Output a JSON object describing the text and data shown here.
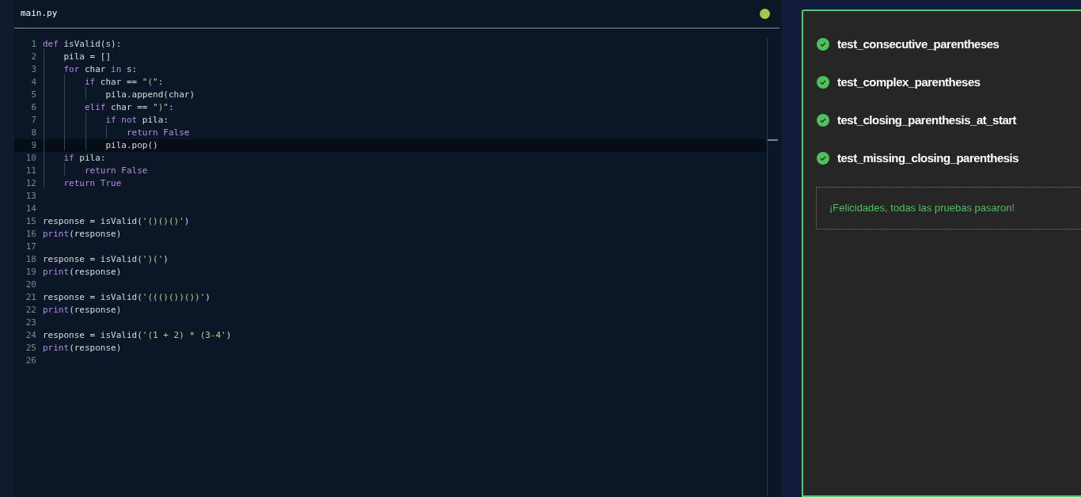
{
  "editor": {
    "file_tab": {
      "label": "main.py"
    },
    "status": {
      "kind": "ok",
      "color": "#a6c94c"
    },
    "lines": [
      {
        "number": "1",
        "selected": false,
        "tokens": [
          {
            "kind": "keyword",
            "text": "def"
          },
          {
            "kind": "plain",
            "text": " isValid(s):"
          }
        ]
      },
      {
        "number": "2",
        "selected": false,
        "tokens": [
          {
            "kind": "plain",
            "text": "    pila = []"
          }
        ]
      },
      {
        "number": "3",
        "selected": false,
        "tokens": [
          {
            "kind": "keyword",
            "text": "    for"
          },
          {
            "kind": "plain",
            "text": " char "
          },
          {
            "kind": "keyword",
            "text": "in"
          },
          {
            "kind": "plain",
            "text": " s:"
          }
        ]
      },
      {
        "number": "4",
        "selected": false,
        "tokens": [
          {
            "kind": "keyword",
            "text": "        if"
          },
          {
            "kind": "plain",
            "text": " char == "
          },
          {
            "kind": "string",
            "text": "\"(\""
          },
          {
            "kind": "plain",
            "text": ":"
          }
        ]
      },
      {
        "number": "5",
        "selected": false,
        "tokens": [
          {
            "kind": "plain",
            "text": "            pila.append(char)"
          }
        ]
      },
      {
        "number": "6",
        "selected": false,
        "tokens": [
          {
            "kind": "keyword",
            "text": "        elif"
          },
          {
            "kind": "plain",
            "text": " char == "
          },
          {
            "kind": "string",
            "text": "\")\""
          },
          {
            "kind": "plain",
            "text": ":"
          }
        ]
      },
      {
        "number": "7",
        "selected": false,
        "tokens": [
          {
            "kind": "keyword",
            "text": "            if not"
          },
          {
            "kind": "plain",
            "text": " pila:"
          }
        ]
      },
      {
        "number": "8",
        "selected": false,
        "tokens": [
          {
            "kind": "keyword",
            "text": "                return False"
          }
        ]
      },
      {
        "number": "9",
        "selected": true,
        "tokens": [
          {
            "kind": "plain",
            "text": "            pila.pop()"
          }
        ]
      },
      {
        "number": "10",
        "selected": false,
        "tokens": [
          {
            "kind": "keyword",
            "text": "    if"
          },
          {
            "kind": "plain",
            "text": " pila:"
          }
        ]
      },
      {
        "number": "11",
        "selected": false,
        "tokens": [
          {
            "kind": "keyword",
            "text": "        return False"
          }
        ]
      },
      {
        "number": "12",
        "selected": false,
        "tokens": [
          {
            "kind": "keyword",
            "text": "    return True"
          }
        ]
      },
      {
        "number": "13",
        "selected": false
      },
      {
        "number": "14",
        "selected": false
      },
      {
        "number": "15",
        "selected": false,
        "tokens": [
          {
            "kind": "plain",
            "text": "response = isValid("
          },
          {
            "kind": "string",
            "text": "'()()()'"
          },
          {
            "kind": "plain",
            "text": ")"
          }
        ]
      },
      {
        "number": "16",
        "selected": false,
        "tokens": [
          {
            "kind": "keyword",
            "text": "print"
          },
          {
            "kind": "plain",
            "text": "(response)"
          }
        ]
      },
      {
        "number": "17",
        "selected": false
      },
      {
        "number": "18",
        "selected": false,
        "tokens": [
          {
            "kind": "plain",
            "text": "response = isValid("
          },
          {
            "kind": "string",
            "text": "')('"
          },
          {
            "kind": "plain",
            "text": ")"
          }
        ]
      },
      {
        "number": "19",
        "selected": false,
        "tokens": [
          {
            "kind": "keyword",
            "text": "print"
          },
          {
            "kind": "plain",
            "text": "(response)"
          }
        ]
      },
      {
        "number": "20",
        "selected": false
      },
      {
        "number": "21",
        "selected": false,
        "tokens": [
          {
            "kind": "plain",
            "text": "response = isValid("
          },
          {
            "kind": "string",
            "text": "'((()())())'"
          },
          {
            "kind": "plain",
            "text": ")"
          }
        ]
      },
      {
        "number": "22",
        "selected": false,
        "tokens": [
          {
            "kind": "keyword",
            "text": "print"
          },
          {
            "kind": "plain",
            "text": "(response)"
          }
        ]
      },
      {
        "number": "23",
        "selected": false
      },
      {
        "number": "24",
        "selected": false,
        "tokens": [
          {
            "kind": "plain",
            "text": "response = isValid("
          },
          {
            "kind": "string",
            "text": "'(1 + 2) * (3-4'"
          },
          {
            "kind": "plain",
            "text": ")"
          }
        ]
      },
      {
        "number": "25",
        "selected": false,
        "tokens": [
          {
            "kind": "keyword",
            "text": "print"
          },
          {
            "kind": "plain",
            "text": "(response)"
          }
        ]
      },
      {
        "number": "26",
        "selected": false
      }
    ]
  },
  "results": {
    "tests": [
      {
        "name": "test_consecutive_parentheses",
        "passed": true
      },
      {
        "name": "test_complex_parentheses",
        "passed": true
      },
      {
        "name": "test_closing_parenthesis_at_start",
        "passed": true
      },
      {
        "name": "test_missing_closing_parenthesis",
        "passed": true
      }
    ],
    "message": {
      "text": "¡Felicidades, todas las pruebas pasaron!",
      "kind": "success"
    }
  }
}
